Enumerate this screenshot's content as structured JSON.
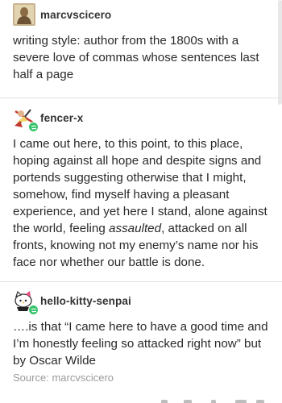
{
  "posts": [
    {
      "username": "marcvscicero",
      "avatar_icon": "sepia-portrait-avatar-icon",
      "body": "writing style: author from the 1800s with a severe love of commas whose sentences last half a page"
    },
    {
      "username": "fencer-x",
      "avatar_icon": "fencer-avatar-icon",
      "badge_icon": "reblog-icon",
      "body_before": "I came out here, to this point, to this place, hoping against all hope and despite signs and portends suggesting otherwise that I might, somehow, find myself having a pleasant experience, and yet here I stand, alone against the world, feeling ",
      "body_emphasis": "assaulted",
      "body_after": ", attacked on all fronts, knowing not my enemy’s name nor his face nor whether our battle is done."
    },
    {
      "username": "hello-kitty-senpai",
      "avatar_icon": "hello-kitty-avatar-icon",
      "badge_icon": "reblog-icon",
      "body": "….is that “I came here to have a good time and I’m honestly feeling so attacked right now” but by Oscar Wilde"
    }
  ],
  "source": {
    "label": "Source:",
    "value": "marcvscicero"
  },
  "colors": {
    "reblog_badge": "#37c46b",
    "divider": "#e2e2e2",
    "source_text": "#9a9a9a"
  }
}
